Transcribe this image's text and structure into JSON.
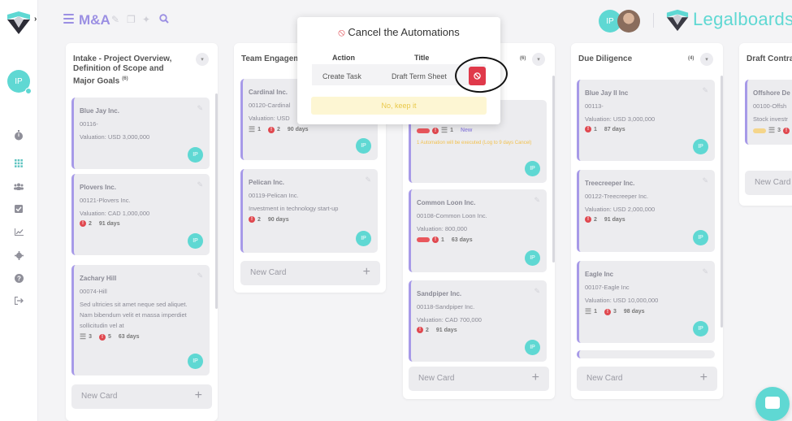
{
  "app": {
    "brand_name": "Legalboards",
    "board_title": "M&A",
    "user_initials": "IP"
  },
  "icons": {
    "sidebar": [
      "stopwatch-icon",
      "grid-icon",
      "people-icon",
      "checkbox-icon",
      "chart-icon",
      "gear-icon",
      "help-icon",
      "logout-icon"
    ],
    "toolbar": [
      "menu-icon",
      "edit-icon",
      "copy-icon",
      "magic-icon",
      "search-icon"
    ]
  },
  "colors": {
    "accent": "#9b8fe3",
    "teal": "#5fd8d3",
    "danger": "#e0394a",
    "warning_bg": "#fdf6d3"
  },
  "columns": [
    {
      "title": "Intake - Project Overview, Definition of Scope and Major Goals",
      "count": "(6)",
      "cards": [
        {
          "name": "Blue Jay Inc.",
          "code": "00116-",
          "desc": "Valuation: USD 3,000,000"
        },
        {
          "name": "Plovers Inc.",
          "code": "00121-Plovers Inc.",
          "desc": "Valuation: CAD 1,000,000",
          "alerts": "2",
          "days": "91 days"
        },
        {
          "name": "Zachary Hill",
          "code": "00074-Hill",
          "desc": "Sed ultricies sit amet neque sed aliquet. Nam bibendum velit et massa imperdiet sollicitudin vel at",
          "tasks": "3",
          "alerts": "5",
          "days": "63 days"
        }
      ],
      "new_card": "New Card"
    },
    {
      "title": "Team Engagem",
      "cards": [
        {
          "name": "Cardinal Inc.",
          "code": "00120-Cardinal",
          "desc": "Valuation: USD",
          "tasks": "1",
          "alerts": "2",
          "days": "90 days"
        },
        {
          "name": "Pelican Inc.",
          "code": "00119-Pelican Inc.",
          "desc": "Investment in technology start-up",
          "alerts": "2",
          "days": "90 days"
        }
      ],
      "new_card": "New Card"
    },
    {
      "title": "",
      "count": "(6)",
      "cards": [
        {
          "tasks": "1",
          "badge": "New",
          "warning": "1 Automation will be executed (Log to 9 days Cancel)"
        },
        {
          "name": "Common Loon Inc.",
          "code": "00108-Common Loon Inc.",
          "desc": "Valuation: 800,000",
          "alerts": "1",
          "days": "63 days"
        },
        {
          "name": "Sandpiper Inc.",
          "code": "00118-Sandpiper Inc.",
          "desc": "Valuation: CAD 700,000",
          "alerts": "2",
          "days": "91 days"
        }
      ],
      "new_card": "New Card"
    },
    {
      "title": "Due Diligence",
      "count": "(4)",
      "cards": [
        {
          "name": "Blue Jay II Inc",
          "code": "00113-",
          "desc": "Valuation: USD 3,000,000",
          "alerts": "1",
          "days": "87 days"
        },
        {
          "name": "Treecreeper Inc.",
          "code": "00122-Treecreeper Inc.",
          "desc": "Valuation: USD 2,000,000",
          "alerts": "2",
          "days": "91 days"
        },
        {
          "name": "Eagle Inc",
          "code": "00107-Eagle Inc",
          "desc": "Valuation: USD 10,000,000",
          "tasks": "1",
          "alerts": "3",
          "days": "98 days"
        }
      ],
      "new_card": "New Card"
    },
    {
      "title": "Draft Contrac",
      "cards": [
        {
          "name": "Offshore De",
          "code": "00100-Offsh",
          "desc": "Stock investr",
          "tasks": "3"
        }
      ],
      "new_card": "New Card"
    }
  ],
  "modal": {
    "title": "Cancel the Automations",
    "col_action": "Action",
    "col_title": "Title",
    "row_action": "Create Task",
    "row_title": "Draft Term Sheet",
    "keep_label": "No, keep it"
  }
}
